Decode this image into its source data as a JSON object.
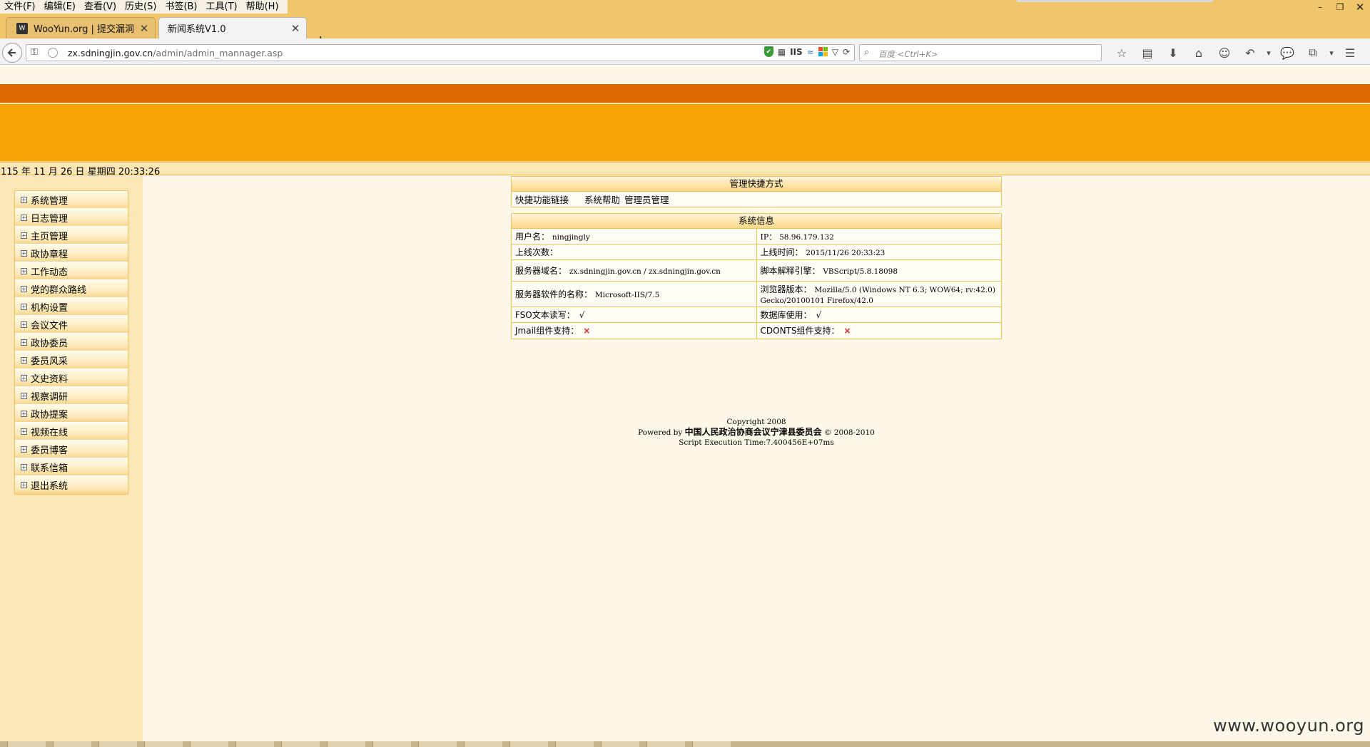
{
  "browser": {
    "menu": [
      "文件(F)",
      "编辑(E)",
      "查看(V)",
      "历史(S)",
      "书签(B)",
      "工具(T)",
      "帮助(H)"
    ],
    "window_controls": {
      "minimize": "–",
      "restore": "❐",
      "close": "✕"
    },
    "tabs": [
      {
        "title": "WooYun.org | 提交漏洞",
        "close": "✕",
        "icon": "W"
      },
      {
        "title": "新闻系统V1.0",
        "close": "✕"
      }
    ],
    "new_tab": "+",
    "url": {
      "host": "zx.sdningjin.gov.cn",
      "path": "/admin/admin_mannager.asp"
    },
    "url_badges": {
      "shield": "✔",
      "iis": "IIS",
      "tilde": "≈",
      "dropdown": "▽",
      "reload": "⟳"
    },
    "search_placeholder": "百度 <Ctrl+K>",
    "toolbar_icons": [
      "☆",
      "▤",
      "⬇",
      "⌂",
      "☺",
      "↶",
      "▾",
      "💬",
      "⧉",
      "▾",
      "☰"
    ]
  },
  "page": {
    "datetime": "115 年 11 月 26 日 星期四 20:33:26",
    "sidebar_items": [
      "系统管理",
      "日志管理",
      "主页管理",
      "政协章程",
      "工作动态",
      "党的群众路线",
      "机构设置",
      "会议文件",
      "政协委员",
      "委员风采",
      "文史资料",
      "视察调研",
      "政协提案",
      "视频在线",
      "委员博客",
      "联系信箱",
      "退出系统"
    ],
    "quick_panel": {
      "title": "管理快捷方式",
      "links": [
        "快捷功能链接",
        "系统帮助",
        "管理员管理"
      ]
    },
    "info_panel": {
      "title": "系统信息",
      "rows": [
        {
          "l_label": "用户名：",
          "l_value": "ningjingly",
          "r_label": "IP：",
          "r_value": "58.96.179.132"
        },
        {
          "l_label": "上线次数：",
          "l_value": "",
          "r_label": "上线时间：",
          "r_value": "2015/11/26 20:33:23"
        },
        {
          "l_label": "服务器域名：",
          "l_value": "zx.sdningjin.gov.cn / zx.sdningjin.gov.cn",
          "r_label": "脚本解释引擎：",
          "r_value": "VBScript/5.8.18098"
        },
        {
          "l_label": "服务器软件的名称：",
          "l_value": "Microsoft-IIS/7.5",
          "r_label": "浏览器版本：",
          "r_value": "Mozilla/5.0 (Windows NT 6.3; WOW64; rv:42.0) Gecko/20100101 Firefox/42.0"
        },
        {
          "l_label": "FSO文本读写：",
          "l_value": "√",
          "r_label": "数据库使用：",
          "r_value": "√"
        },
        {
          "l_label": "Jmail组件支持：",
          "l_value": "×",
          "r_label": "CDONTS组件支持：",
          "r_value": "×"
        }
      ]
    },
    "footer": {
      "copyright": "Copyright 2008",
      "powered_prefix": "Powered by",
      "org": "中国人民政治协商会议宁津县委员会",
      "powered_suffix": "© 2008-2010",
      "exec_time": "Script Execution Time:7.400456E+07ms"
    },
    "watermark": "www.wooyun.org"
  }
}
